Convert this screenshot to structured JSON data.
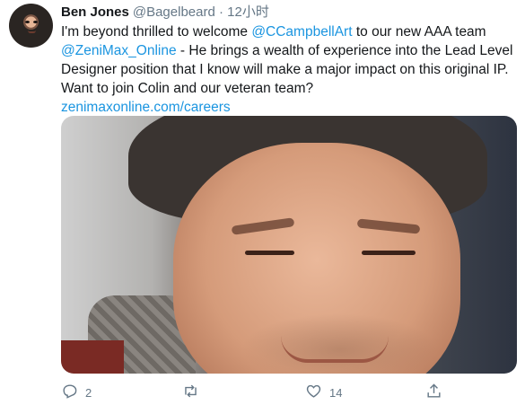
{
  "tweet": {
    "author_name": "Ben Jones",
    "author_handle": "@Bagelbeard",
    "separator": "·",
    "time": "12小时",
    "text_1": "I'm beyond thrilled to welcome ",
    "mention_1": "@CCampbellArt",
    "text_2": " to our new AAA team ",
    "mention_2": "@ZeniMax_Online",
    "text_3": " - He brings a wealth of experience into the Lead Level Designer position that I know will make a major impact on this original IP. Want to join Colin and our veteran team?",
    "link": "zenimaxonline.com/careers"
  },
  "actions": {
    "reply_count": "2",
    "retweet_count": "",
    "like_count": "14"
  },
  "icons": {
    "reply": "reply-icon",
    "retweet": "retweet-icon",
    "like": "heart-icon",
    "share": "share-icon"
  },
  "colors": {
    "link": "#1b95e0",
    "muted": "#657786",
    "text": "#14171a"
  }
}
